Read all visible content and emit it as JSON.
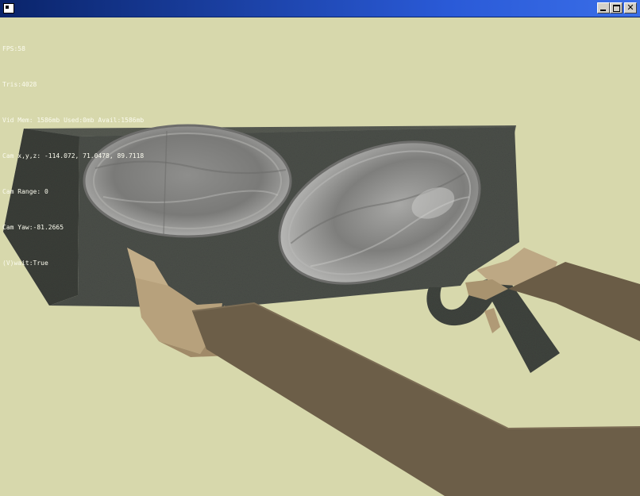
{
  "window": {
    "title": "",
    "buttons": {
      "minimize": "",
      "maximize": "",
      "close": "✕"
    }
  },
  "hud": {
    "fps": "FPS:58",
    "tris": "Tris:4028",
    "vid_mem": "Vid Mem: 1586mb Used:0mb Avail:1586mb",
    "cam_xyz": "Cam x,y,z: -114.072, 71.0478, 89.7118",
    "cam_range": "Cam Range: 0",
    "cam_yaw": "Cam Yaw:-81.2665",
    "vwait": "(V)wait:True"
  },
  "colors": {
    "background": "#d7d8ac",
    "box_front": "#4c504a",
    "box_left": "#3a3e38",
    "box_top": "#5a5e56",
    "speaker_cone": "#9a9a98",
    "skin_light": "#c0aa86",
    "skin_dark": "#6c5e48"
  }
}
